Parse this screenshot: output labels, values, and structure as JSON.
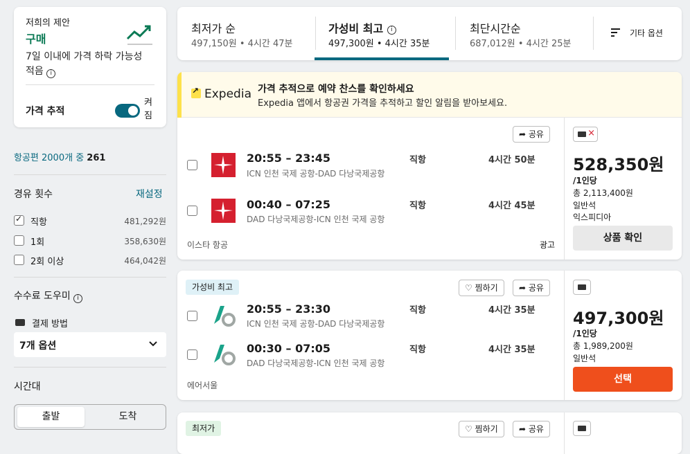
{
  "advice": {
    "title": "저희의 제안",
    "verdict": "구매",
    "desc": "7일 이내에 가격 하락 가능성 적음",
    "track_label": "가격 추적",
    "toggle_state": "켜짐",
    "accent": "#0b7a55"
  },
  "results": {
    "prefix": "항공편 2000개 중",
    "count": "261"
  },
  "stops": {
    "title": "경유 횟수",
    "reset": "재설정",
    "options": [
      {
        "label": "직항",
        "price": "481,292원",
        "checked": true
      },
      {
        "label": "1회",
        "price": "358,630원",
        "checked": false
      },
      {
        "label": "2회 이상",
        "price": "464,042원",
        "checked": false
      }
    ]
  },
  "fees": {
    "title": "수수료 도우미",
    "payment_label": "결제 방법",
    "dropdown_value": "7개 옵션"
  },
  "timeband": {
    "title": "시간대",
    "depart": "출발",
    "arrive": "도착"
  },
  "sort": {
    "tabs": [
      {
        "name": "최저가 순",
        "sub": "497,150원 • 4시간 47분"
      },
      {
        "name": "가성비 최고",
        "sub": "497,300원 • 4시간 35분"
      },
      {
        "name": "최단시간순",
        "sub": "687,012원 • 4시간 25분"
      }
    ],
    "more": "기타 옵션"
  },
  "ad": {
    "brand": "Expedia",
    "headline": "가격 추적으로 예약 찬스를 확인하세요",
    "sub": "Expedia 앱에서 항공권 가격을 추적하고 할인 알림을 받아보세요.",
    "share": "공유",
    "legs": [
      {
        "time": "20:55 – 23:45",
        "route": "ICN 인천 국제 공항-DAD 다낭국제공항",
        "stops": "직항",
        "dur": "4시간 50분"
      },
      {
        "time": "00:40 – 07:25",
        "route": "DAD 다낭국제공항-ICN 인천 국제 공항",
        "stops": "직항",
        "dur": "4시간 45분"
      }
    ],
    "carrier": "이스타 항공",
    "ad_label": "광고",
    "price": "528,350원",
    "per": "/1인당",
    "total": "총 2,113,400원",
    "cabin": "일반석",
    "provider": "익스피디아",
    "cta": "상품 확인"
  },
  "best": {
    "badge": "가성비 최고",
    "save": "찜하기",
    "share": "공유",
    "legs": [
      {
        "time": "20:55 – 23:30",
        "route": "ICN 인천 국제 공항-DAD 다낭국제공항",
        "stops": "직항",
        "dur": "4시간 35분"
      },
      {
        "time": "00:30 – 07:05",
        "route": "DAD 다낭국제공항-ICN 인천 국제 공항",
        "stops": "직항",
        "dur": "4시간 35분"
      }
    ],
    "carrier": "에어서울",
    "price": "497,300원",
    "per": "/1인당",
    "total": "총 1,989,200원",
    "cabin": "일반석",
    "cta": "선택",
    "cta_color": "#ef4f1c"
  },
  "cheapest": {
    "badge": "최저가",
    "save": "찜하기",
    "share": "공유"
  }
}
